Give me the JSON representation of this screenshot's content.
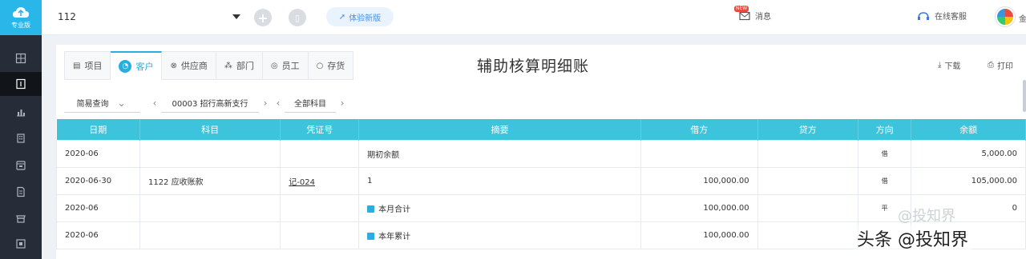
{
  "app": {
    "logo_text": "专业版",
    "brand_color": "#29b6e8"
  },
  "sidebar": {
    "items": [
      {
        "icon": "voucher-icon",
        "active": false
      },
      {
        "icon": "ledger-icon",
        "active": true
      },
      {
        "icon": "report-chart-icon",
        "active": false
      },
      {
        "icon": "building-icon",
        "active": false
      },
      {
        "icon": "inventory-icon",
        "active": false
      },
      {
        "icon": "document-icon",
        "active": false
      },
      {
        "icon": "shop-icon",
        "active": false
      },
      {
        "icon": "settings-icon",
        "active": false
      }
    ]
  },
  "header": {
    "account": "112",
    "trial_label": "体验新版",
    "message_label": "消息",
    "message_badge": "NEW",
    "online_label": "在线客服",
    "user_name": "金"
  },
  "tabs": [
    {
      "label": "项目",
      "icon": "list-icon",
      "active": false
    },
    {
      "label": "客户",
      "icon": "customer-icon",
      "active": true
    },
    {
      "label": "供应商",
      "icon": "supplier-icon",
      "active": false
    },
    {
      "label": "部门",
      "icon": "department-icon",
      "active": false
    },
    {
      "label": "员工",
      "icon": "employee-icon",
      "active": false
    },
    {
      "label": "存货",
      "icon": "stock-icon",
      "active": false
    }
  ],
  "page": {
    "title": "辅助核算明细账"
  },
  "actions": {
    "download_label": "下载",
    "print_label": "打印"
  },
  "filters": {
    "mode": "简易查询",
    "customer": "00003 招行高新支行",
    "subject": "全部科目"
  },
  "table": {
    "headers": [
      "日期",
      "科目",
      "凭证号",
      "摘要",
      "借方",
      "贷方",
      "方向",
      "余额"
    ],
    "rows": [
      {
        "date": "2020-06",
        "subject": "",
        "voucher": "",
        "summary": "期初余额",
        "summary_icon": false,
        "debit": "",
        "credit": "",
        "direction": "借",
        "balance": "5,000.00"
      },
      {
        "date": "2020-06-30",
        "subject": "1122 应收账款",
        "voucher": "记-024",
        "summary": "1",
        "summary_icon": false,
        "debit": "100,000.00",
        "credit": "",
        "direction": "借",
        "balance": "105,000.00"
      },
      {
        "date": "2020-06",
        "subject": "",
        "voucher": "",
        "summary": "本月合计",
        "summary_icon": true,
        "debit": "100,000.00",
        "credit": "",
        "direction": "平",
        "balance": "0"
      },
      {
        "date": "2020-06",
        "subject": "",
        "voucher": "",
        "summary": "本年累计",
        "summary_icon": true,
        "debit": "100,000.00",
        "credit": "",
        "direction": "",
        "balance": ""
      }
    ]
  },
  "watermarks": {
    "faint": "@投知界",
    "main": "头条 @投知界"
  }
}
